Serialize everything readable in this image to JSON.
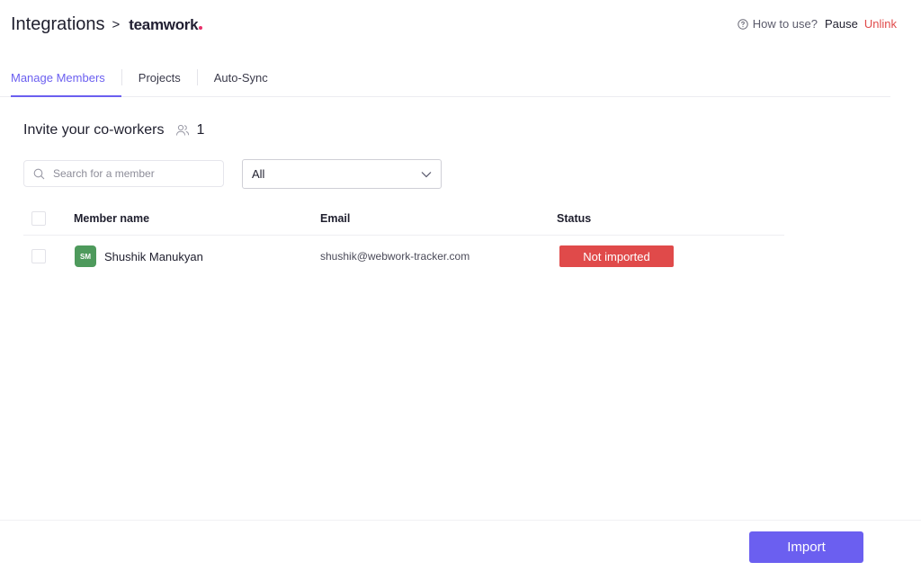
{
  "colors": {
    "accent": "#6b5ff0",
    "danger": "#e04a4a",
    "brand_dot": "#e8306a",
    "avatar_bg": "#4e9a5c"
  },
  "header": {
    "title": "Integrations",
    "separator": ">",
    "brand": "teamwork",
    "how_to_use": "How to use?",
    "pause": "Pause",
    "unlink": "Unlink"
  },
  "tabs": [
    {
      "label": "Manage Members",
      "active": true
    },
    {
      "label": "Projects",
      "active": false
    },
    {
      "label": "Auto-Sync",
      "active": false
    }
  ],
  "section": {
    "title": "Invite your co-workers",
    "count": "1"
  },
  "search": {
    "placeholder": "Search for a member",
    "value": ""
  },
  "filter": {
    "selected": "All"
  },
  "table": {
    "columns": [
      "Member name",
      "Email",
      "Status"
    ],
    "rows": [
      {
        "initials": "SM",
        "name": "Shushik Manukyan",
        "email": "shushik@webwork-tracker.com",
        "status": "Not imported"
      }
    ]
  },
  "footer": {
    "import_label": "Import"
  }
}
